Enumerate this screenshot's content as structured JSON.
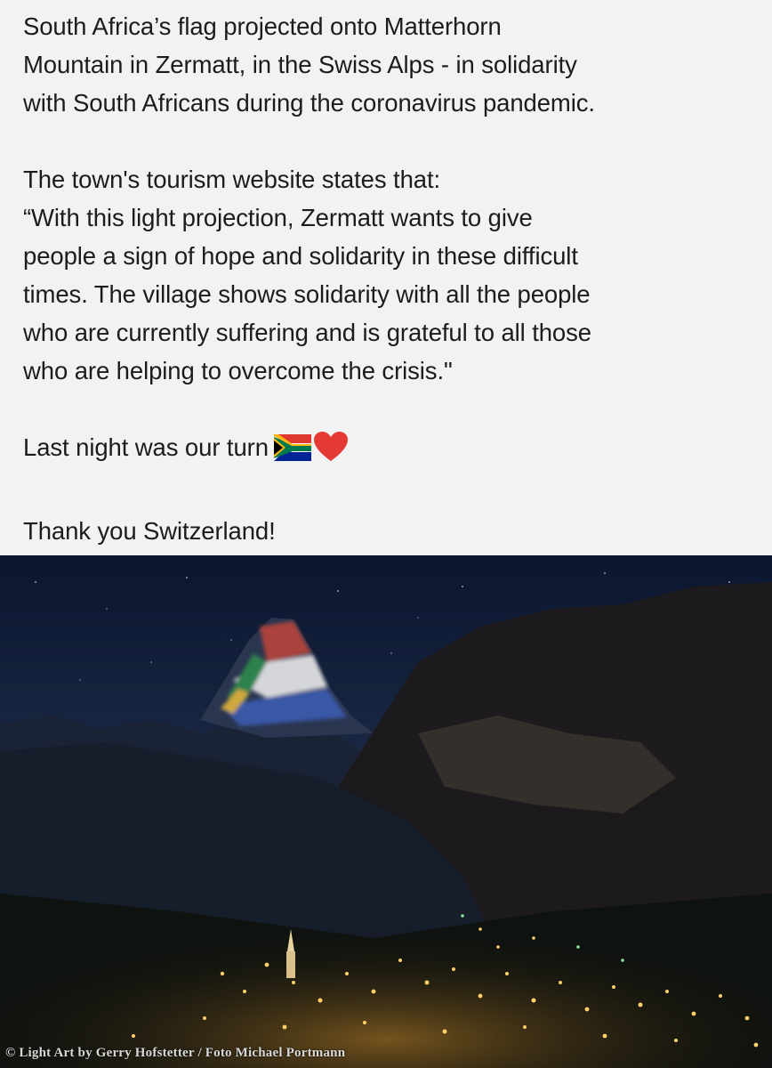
{
  "post": {
    "paragraph_1_lines": [
      "South Africa’s flag projected onto Matterhorn",
      "Mountain in Zermatt, in the Swiss Alps - in solidarity",
      "with South Africans during the coronavirus pandemic."
    ],
    "paragraph_2_lines": [
      "The town's tourism website states that:",
      "“With this light projection, Zermatt wants to give",
      "people a sign of hope and solidarity in these difficult",
      "times. The village shows solidarity with all the people",
      "who are currently suffering and is grateful to all those",
      "who are helping to overcome the crisis.\""
    ],
    "line_turn": "Last night was our turn",
    "line_turn_emojis": [
      "south-africa-flag-icon",
      "red-heart-icon"
    ],
    "line_thanks": "Thank you Switzerland!"
  },
  "photo": {
    "caption": "© Light Art by Gerry Hofstetter / Foto Michael Portmann"
  }
}
